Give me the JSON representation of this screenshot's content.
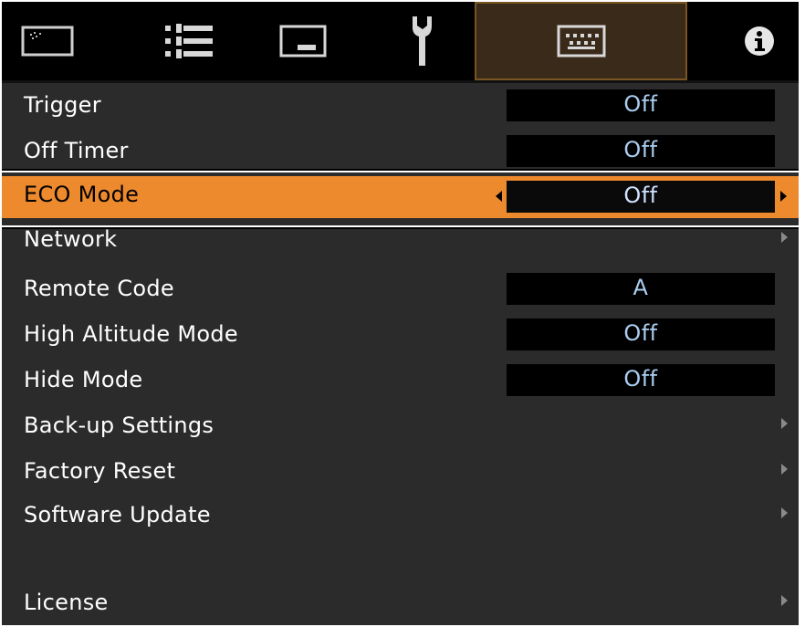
{
  "tabs": [
    {
      "icon": "picture-icon",
      "active": false
    },
    {
      "icon": "adjust-sliders-icon",
      "active": false
    },
    {
      "icon": "display-icon",
      "active": false
    },
    {
      "icon": "wrench-icon",
      "active": false
    },
    {
      "icon": "keyboard-icon",
      "active": true
    },
    {
      "icon": "info-icon",
      "active": false
    }
  ],
  "menu": [
    {
      "label": "Trigger",
      "value": "Off"
    },
    {
      "label": "Off Timer",
      "value": "Off"
    },
    {
      "label": "ECO Mode",
      "value": "Off",
      "selected": true
    },
    {
      "label": "Network",
      "submenu": true
    },
    {
      "label": "Remote Code",
      "value": "A"
    },
    {
      "label": "High Altitude Mode",
      "value": "Off"
    },
    {
      "label": "Hide Mode",
      "value": "Off"
    },
    {
      "label": "Back-up Settings",
      "submenu": true
    },
    {
      "label": "Factory Reset",
      "submenu": true
    },
    {
      "label": "Software Update",
      "submenu": true
    },
    {
      "label": "License",
      "submenu": true
    }
  ],
  "colors": {
    "highlight": "#ee8a2e",
    "value_text": "#a9cdf0",
    "menu_bg": "#2b2b2b"
  }
}
